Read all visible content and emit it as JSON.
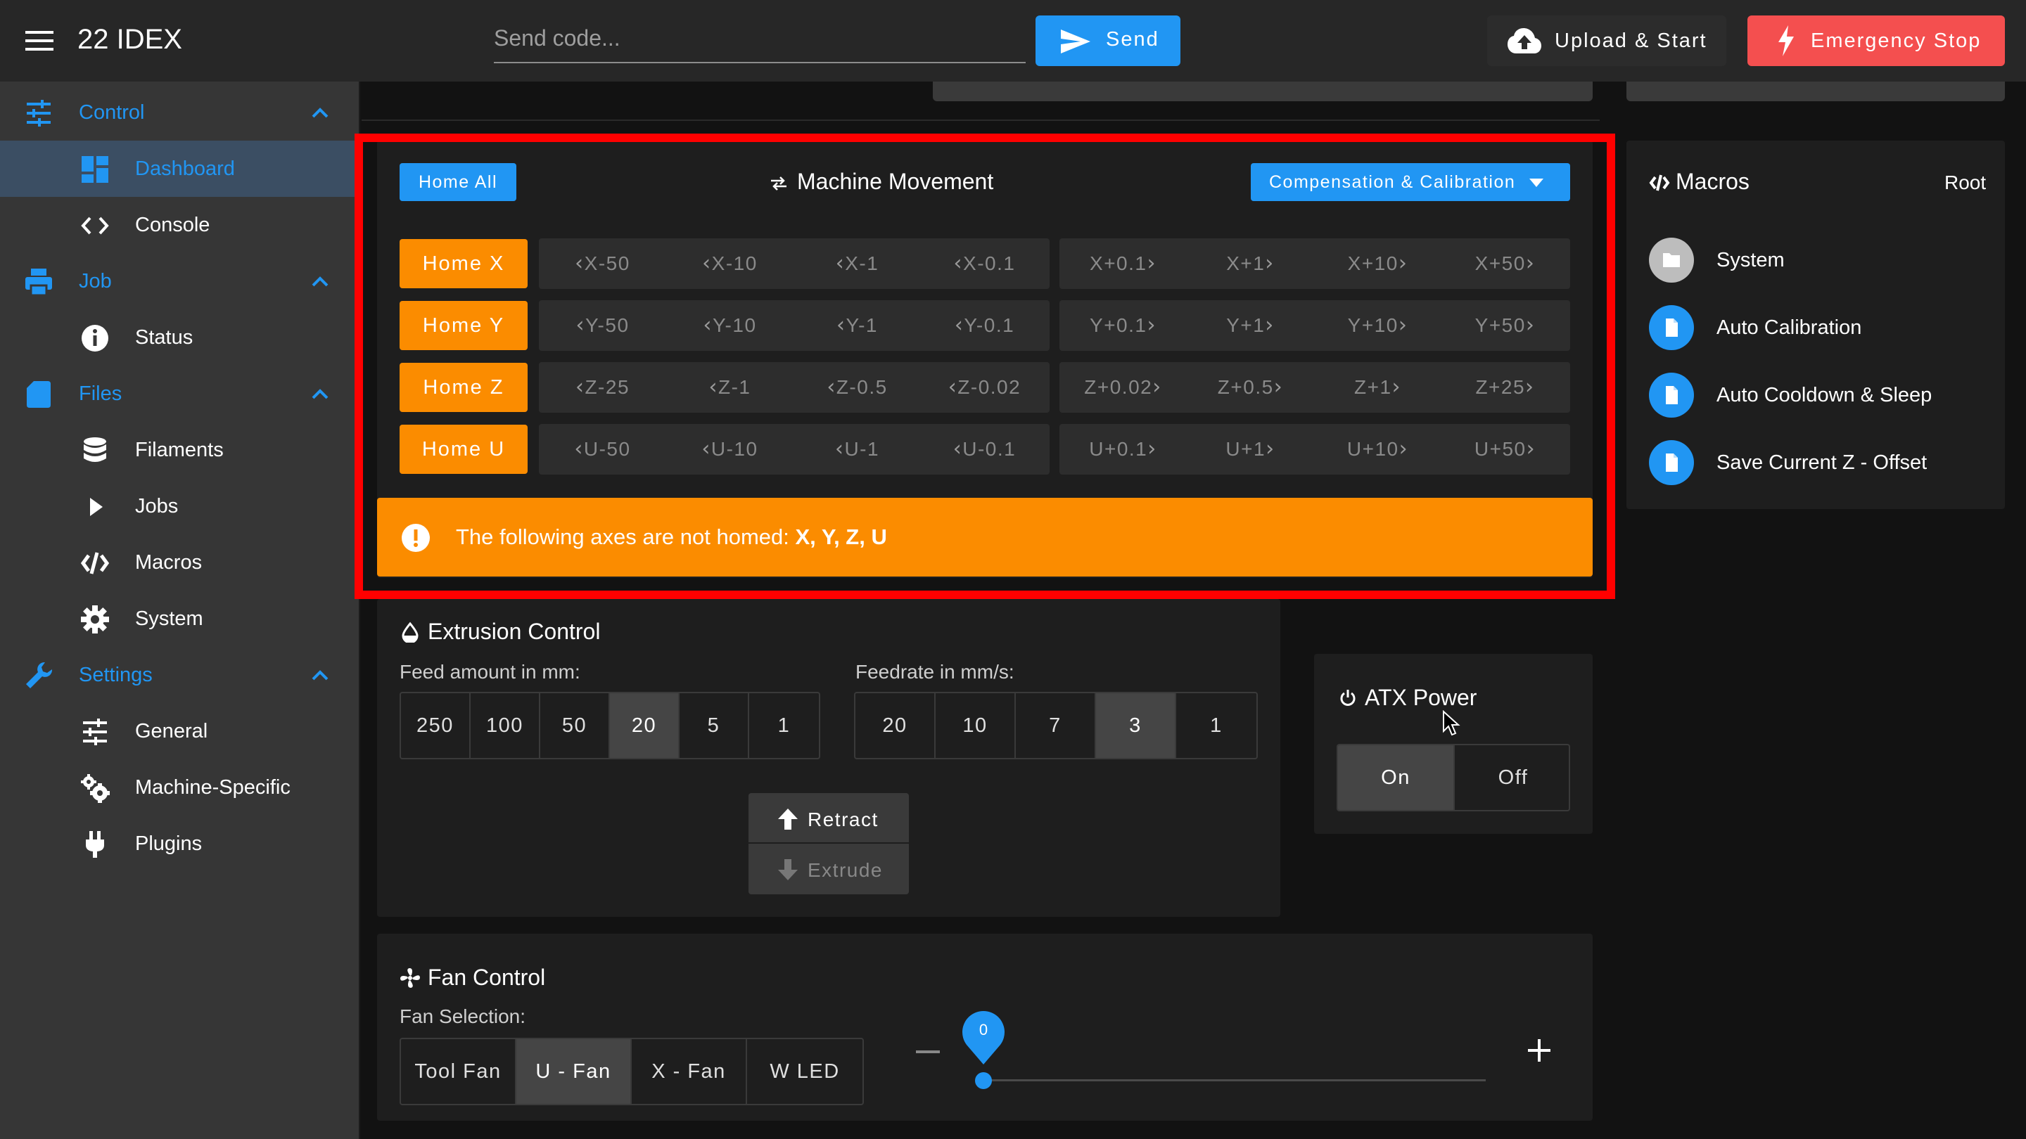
{
  "app": {
    "title": "22 IDEX"
  },
  "header": {
    "code_placeholder": "Send code...",
    "send_label": "Send",
    "upload_label": "Upload & Start",
    "estop_label": "Emergency Stop"
  },
  "sidebar": {
    "groups": [
      {
        "label": "Control",
        "items": [
          {
            "label": "Dashboard",
            "active": true
          },
          {
            "label": "Console"
          }
        ]
      },
      {
        "label": "Job",
        "items": [
          {
            "label": "Status"
          }
        ]
      },
      {
        "label": "Files",
        "items": [
          {
            "label": "Filaments"
          },
          {
            "label": "Jobs"
          },
          {
            "label": "Macros"
          },
          {
            "label": "System"
          }
        ]
      },
      {
        "label": "Settings",
        "items": [
          {
            "label": "General"
          },
          {
            "label": "Machine-Specific"
          },
          {
            "label": "Plugins"
          }
        ]
      }
    ]
  },
  "movement": {
    "title": "Machine Movement",
    "home_all": "Home All",
    "compensation": "Compensation & Calibration",
    "rows": [
      {
        "home": "Home X",
        "minus": [
          "X-50",
          "X-10",
          "X-1",
          "X-0.1"
        ],
        "plus": [
          "X+0.1",
          "X+1",
          "X+10",
          "X+50"
        ]
      },
      {
        "home": "Home Y",
        "minus": [
          "Y-50",
          "Y-10",
          "Y-1",
          "Y-0.1"
        ],
        "plus": [
          "Y+0.1",
          "Y+1",
          "Y+10",
          "Y+50"
        ]
      },
      {
        "home": "Home Z",
        "minus": [
          "Z-25",
          "Z-1",
          "Z-0.5",
          "Z-0.02"
        ],
        "plus": [
          "Z+0.02",
          "Z+0.5",
          "Z+1",
          "Z+25"
        ]
      },
      {
        "home": "Home U",
        "minus": [
          "U-50",
          "U-10",
          "U-1",
          "U-0.1"
        ],
        "plus": [
          "U+0.1",
          "U+1",
          "U+10",
          "U+50"
        ]
      }
    ],
    "warning_text": "The following axes are not homed: ",
    "warning_axes": "X, Y, Z, U"
  },
  "macros": {
    "title": "Macros",
    "root": "Root",
    "items": [
      {
        "label": "System",
        "type": "folder"
      },
      {
        "label": "Auto Calibration",
        "type": "file"
      },
      {
        "label": "Auto Cooldown & Sleep",
        "type": "file"
      },
      {
        "label": "Save Current Z - Offset",
        "type": "file"
      }
    ]
  },
  "extrusion": {
    "title": "Extrusion Control",
    "feed_label": "Feed amount in mm:",
    "feed_options": [
      "250",
      "100",
      "50",
      "20",
      "5",
      "1"
    ],
    "feed_selected": "20",
    "rate_label": "Feedrate in mm/s:",
    "rate_options": [
      "20",
      "10",
      "7",
      "3",
      "1"
    ],
    "rate_selected": "3",
    "retract": "Retract",
    "extrude": "Extrude"
  },
  "atx": {
    "title": "ATX Power",
    "on": "On",
    "off": "Off",
    "selected": "On"
  },
  "fan": {
    "title": "Fan Control",
    "selection_label": "Fan Selection:",
    "options": [
      "Tool Fan",
      "U - Fan",
      "X - Fan",
      "W LED"
    ],
    "selected": "U - Fan",
    "value": "0"
  },
  "colors": {
    "accent": "#2196f3",
    "warning": "#fb8c00",
    "estop": "#f44f4f",
    "highlight": "#ff0000"
  }
}
